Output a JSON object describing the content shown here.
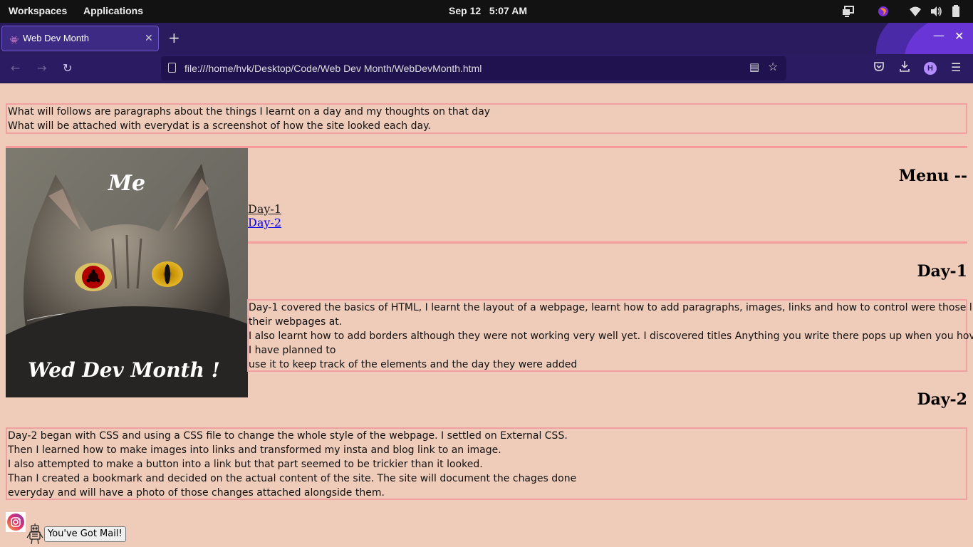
{
  "topbar": {
    "workspaces": "Workspaces",
    "applications": "Applications",
    "date": "Sep 12",
    "time": "5:07 AM",
    "tray_icons": [
      "display-icon",
      "firefox-icon",
      "wifi-icon",
      "volume-icon",
      "battery-icon"
    ]
  },
  "browser": {
    "tab_title": "Web Dev Month",
    "url": "file:///home/hvk/Desktop/Code/Web Dev Month/WebDevMonth.html",
    "profile_initial": "H"
  },
  "page": {
    "intro": [
      "What will follows are paragraphs about the things I learnt on a day and my thoughts on that day",
      "What will be attached with everydat is a screenshot of how the site looked each day."
    ],
    "hero_top": "Me",
    "hero_bottom": "Wed Dev Month !",
    "menu_heading": "Menu --",
    "menu_links": [
      "Day-1",
      "Day-2"
    ],
    "day1_heading": "Day-1",
    "day1_lines": [
      "Day-1 covered the basics of HTML, I learnt the layout of a webpage, learnt how to add paragraphs, images, links and how to control were those links open",
      "their webpages at.",
      "I also learnt how to add borders although they were not working very well yet. I discovered titles Anything you write there pops up when you hover over it,",
      "I have planned to",
      "use it to keep track of the elements and the day they were added"
    ],
    "day2_heading": "Day-2",
    "day2_lines": [
      "Day-2 began with CSS and using a CSS file to change the whole style of the webpage. I settled on External CSS.",
      "Then I learned how to make images into links and transformed my insta and blog link to an image.",
      "I also attempted to make a button into a link but that part seemed to be trickier than it looked.",
      "Than I created a bookmark and decided on the actual content of the site. The site will document the chages done",
      "everyday and will have a photo of those changes attached alongside them."
    ],
    "mail_button": "You've Got Mail!"
  },
  "colors": {
    "page_bg": "#efcbb9",
    "border_pink": "#f59b9b",
    "link_visited": "#1a1a1a",
    "link_unvisited": "#0000ee"
  }
}
